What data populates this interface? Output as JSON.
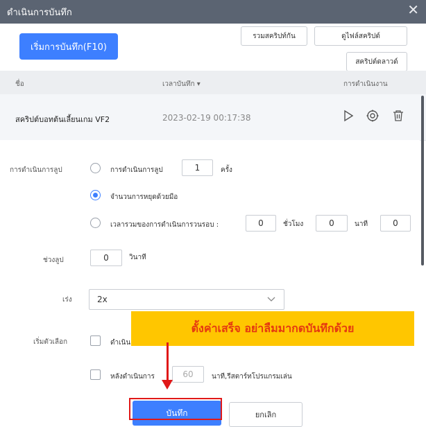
{
  "window": {
    "title": "ดำเนินการบันทึก"
  },
  "toolbar": {
    "start_record": "เริ่มการบันทึก(F10)",
    "merge_scripts": "รวมสคริปท์กัน",
    "view_script_file": "ดูไฟล์สคริปต์",
    "script_download": "สคริปต์ดลาวด์"
  },
  "table": {
    "col_name": "ชื่อ",
    "col_time": "เวลาบันทึก ▾",
    "col_action": "การดำเนินงาน",
    "rows": [
      {
        "name": "สคริปต์บอทต้นเลี้ยนเกม VF2",
        "time": "2023-02-19 00:17:38"
      }
    ]
  },
  "settings": {
    "loop_label": "การดำเนินการลูป",
    "opt_loop_count": "การดำเนินการลูป",
    "loop_count": "1",
    "times_unit": "ครั้ง",
    "opt_manual_stop": "จำนวนการหยุดด้วยมือ",
    "opt_total_time": "เวลารวมของการดำเนินการวนรอบ :",
    "hours_value": "0",
    "hours_unit": "ชั่วโมง",
    "minutes_value": "0",
    "minutes_unit": "นาที",
    "extra_value": "0",
    "interval_label": "ช่วงลูป",
    "interval_value": "0",
    "interval_unit": "วินาที",
    "speed_label": "เร่ง",
    "speed_value": "2x",
    "start_option_label": "เริ่มตัวเลือก",
    "start_option_1": "ดำเนิน",
    "start_option_2": "หลังดำเนินการ",
    "restart_minutes": "60",
    "restart_text": "นาที,รีสตาร์ทโปรแกรมเล่น"
  },
  "annotation": {
    "banner": "ตั้งค่าเสร็จ อย่าลืมมากดบันทึกด้วย"
  },
  "footer": {
    "save": "บันทึก",
    "cancel": "ยกเลิก"
  },
  "colors": {
    "accent": "#3d7fff",
    "title_bar": "#5b6472",
    "banner": "#ffc600",
    "banner_text": "#e53910",
    "highlight": "#e01818"
  }
}
